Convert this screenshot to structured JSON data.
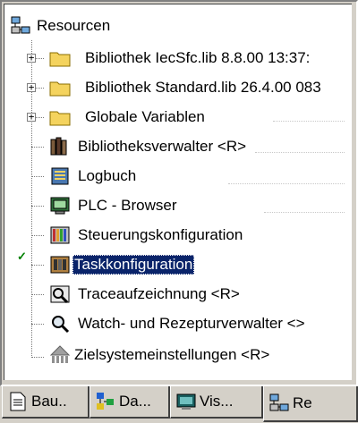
{
  "tree": {
    "root_label": "Resourcen",
    "items": [
      {
        "label": "Bibliothek IecSfc.lib 8.8.00 13:37:",
        "icon": "folder-icon",
        "expandable": true
      },
      {
        "label": "Bibliothek Standard.lib 26.4.00 083",
        "icon": "folder-icon",
        "expandable": true
      },
      {
        "label": "Globale Variablen",
        "icon": "folder-icon",
        "expandable": true
      },
      {
        "label": "Bibliotheksverwalter <R>",
        "icon": "library-books-icon",
        "expandable": false
      },
      {
        "label": "Logbuch",
        "icon": "logbook-icon",
        "expandable": false
      },
      {
        "label": "PLC - Browser",
        "icon": "plc-monitor-icon",
        "expandable": false
      },
      {
        "label": "Steuerungskonfiguration",
        "icon": "controller-config-icon",
        "expandable": false
      },
      {
        "label": "Taskkonfiguration",
        "icon": "task-config-icon",
        "expandable": false,
        "selected": true,
        "checked": true
      },
      {
        "label": "Traceaufzeichnung <R>",
        "icon": "trace-icon",
        "expandable": false
      },
      {
        "label": "Watch- und Rezepturverwalter <>",
        "icon": "magnifier-icon",
        "expandable": false
      },
      {
        "label": "Zielsystemeinstellungen <R>",
        "icon": "target-system-icon",
        "expandable": false
      }
    ]
  },
  "tabs": [
    {
      "label": "Bau..",
      "icon": "document-icon"
    },
    {
      "label": "Da...",
      "icon": "datatypes-icon"
    },
    {
      "label": "Vis...",
      "icon": "visualization-icon"
    },
    {
      "label": "Re",
      "icon": "resources-icon",
      "active": true
    }
  ],
  "colors": {
    "selection": "#0a246a",
    "folder": "#f4d35e",
    "window_bg": "#d4d0c8"
  }
}
